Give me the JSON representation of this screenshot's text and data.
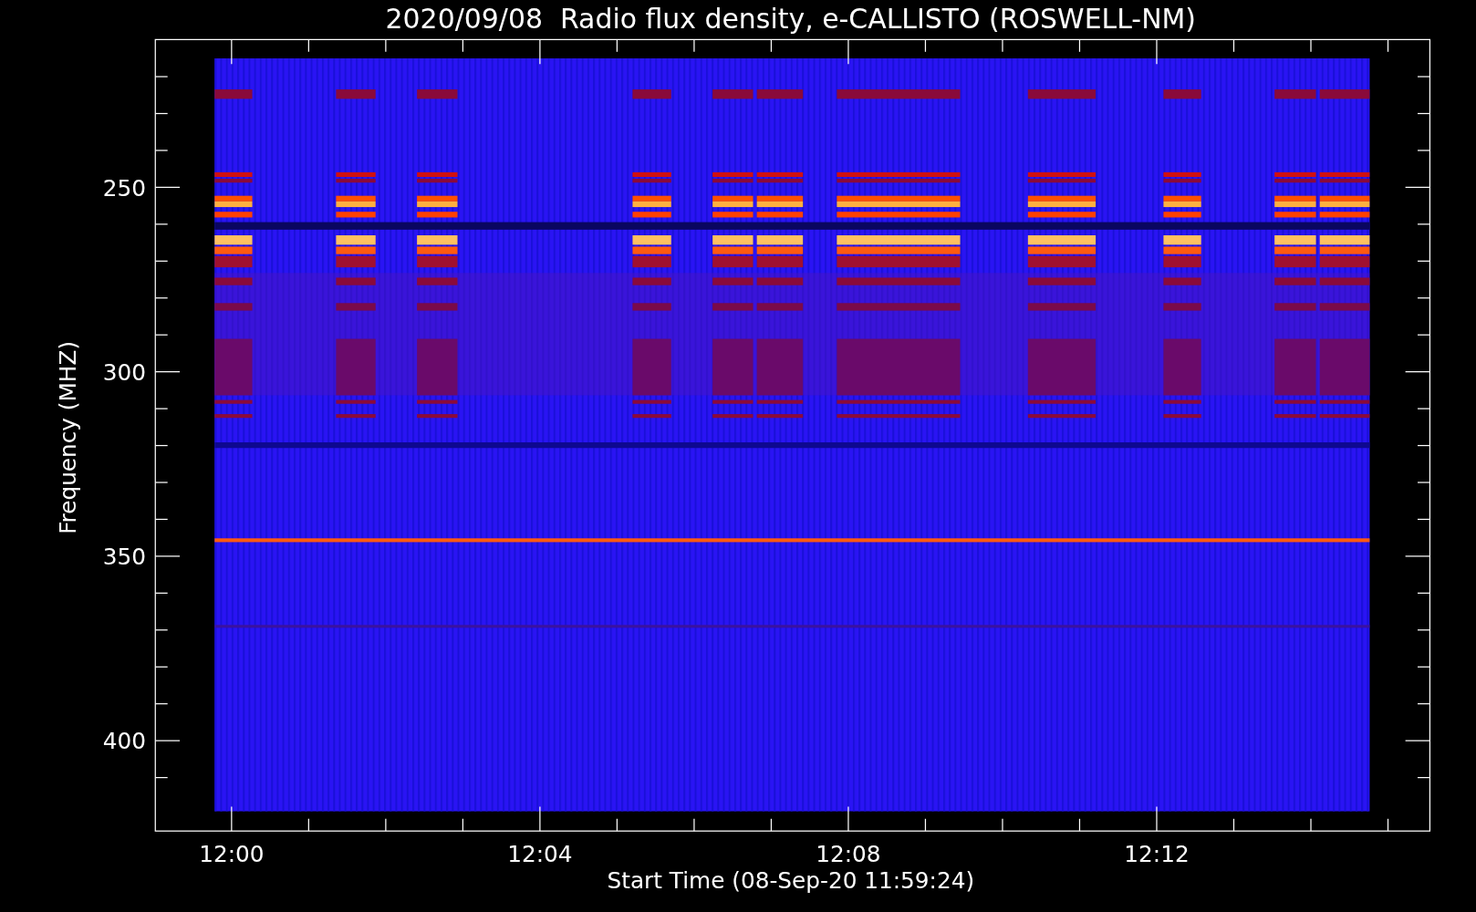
{
  "title": "2020/09/08  Radio flux density, e-CALLISTO (ROSWELL-NM)",
  "y_axis": {
    "label": "Frequency (MHZ)",
    "ticks": [
      "250",
      "300",
      "350",
      "400"
    ]
  },
  "x_axis": {
    "label": "Start Time (08-Sep-20 11:59:24)",
    "ticks": [
      "12:00",
      "12:04",
      "12:08",
      "12:12"
    ]
  }
}
